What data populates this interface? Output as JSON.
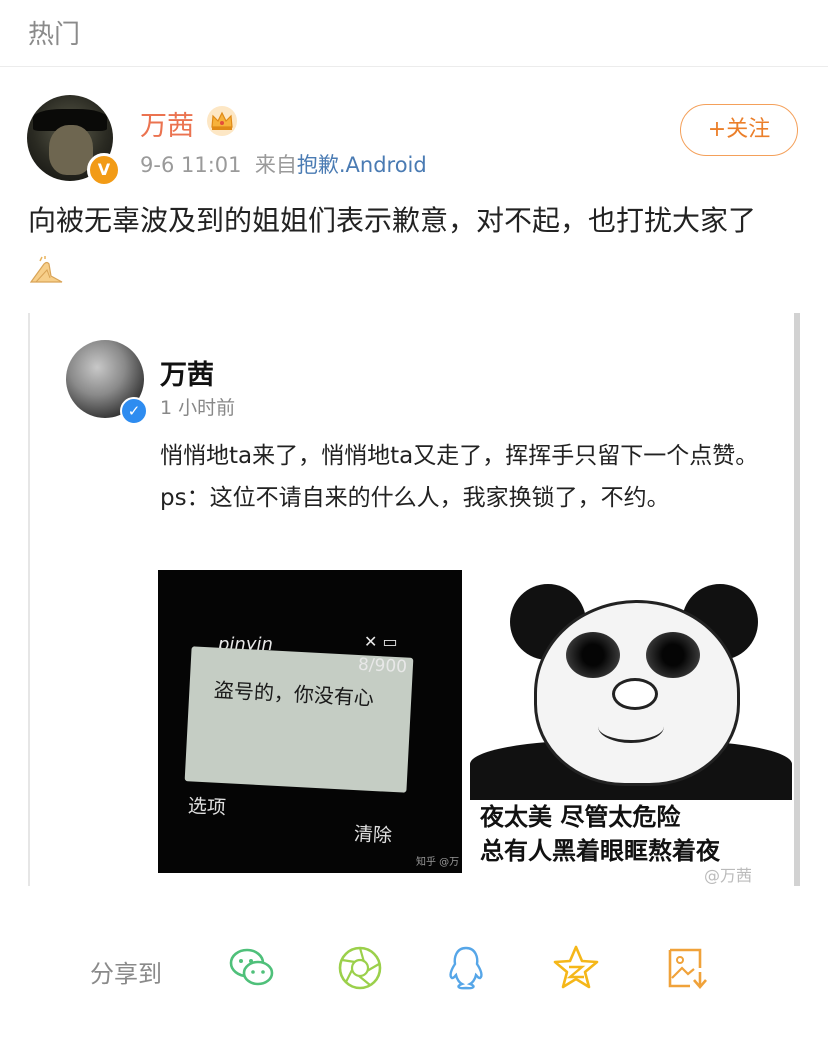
{
  "header": {
    "title": "热门"
  },
  "post": {
    "author": "万茜",
    "time": "9-6 11:01",
    "source_prefix": "来自",
    "source": "抱歉.Android",
    "follow_label": "+关注",
    "text": "向被无辜波及到的姐姐们表示歉意，对不起，也打扰大家了"
  },
  "embed": {
    "author": "万茜",
    "time": "1 小时前",
    "text_line1": "悄悄地ta来了，悄悄地ta又走了，挥挥手只留下一个点赞。",
    "text_line2": "ps：这位不请自来的什么人，我家换锁了，不约。",
    "phone_image": {
      "ime": "pinyin",
      "counter": "8/900",
      "message": "盗号的，你没有心",
      "left_soft_key": "选项",
      "right_soft_key": "清除",
      "watermark": "知乎 @万"
    },
    "panda_image": {
      "caption_line1": "夜太美 尽管太危险",
      "caption_line2": "总有人黑着眼眶熬着夜",
      "watermark": "@万茜"
    }
  },
  "share": {
    "label": "分享到",
    "icons": [
      "wechat-icon",
      "moments-icon",
      "qq-icon",
      "qzone-icon",
      "save-image-icon"
    ]
  },
  "colors": {
    "accent": "#eb7350",
    "link": "#4a7bb3",
    "muted": "#9a9a9a"
  }
}
